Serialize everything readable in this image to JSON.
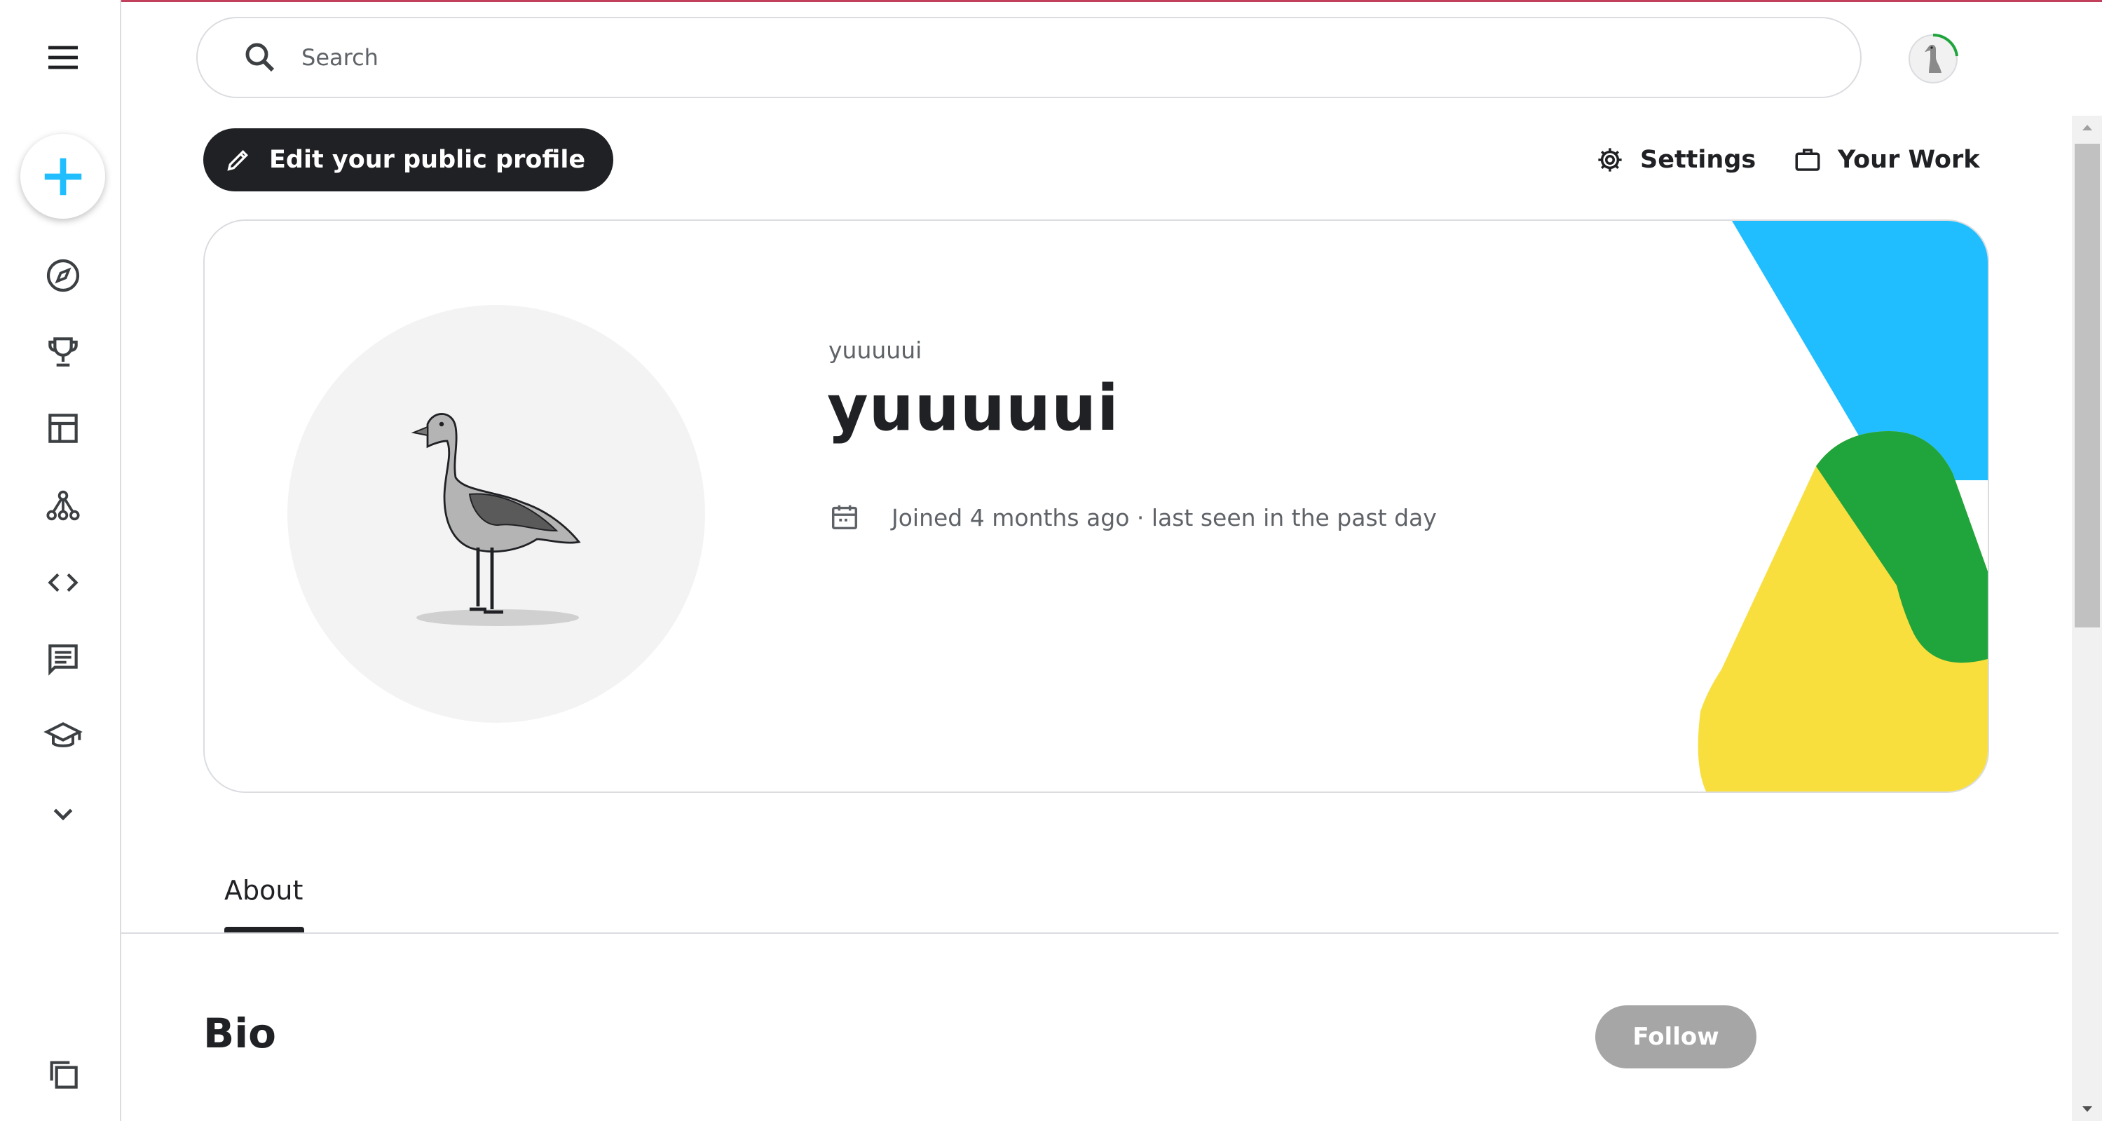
{
  "search": {
    "placeholder": "Search"
  },
  "sidebar": {
    "items": [
      {
        "icon": "menu-icon"
      },
      {
        "icon": "plus-icon"
      },
      {
        "icon": "compass-icon"
      },
      {
        "icon": "trophy-icon"
      },
      {
        "icon": "table-icon"
      },
      {
        "icon": "models-icon"
      },
      {
        "icon": "code-icon"
      },
      {
        "icon": "discussion-icon"
      },
      {
        "icon": "learn-icon"
      },
      {
        "icon": "chevron-down-icon"
      },
      {
        "icon": "copy-icon"
      }
    ]
  },
  "toolbar": {
    "edit_label": "Edit your public profile",
    "settings_label": "Settings",
    "your_work_label": "Your Work"
  },
  "profile": {
    "username": "yuuuuui",
    "display_name": "yuuuuui",
    "joined_text": "Joined 4 months ago · last seen in the past day"
  },
  "tabs": [
    {
      "label": "About",
      "active": true
    }
  ],
  "bio": {
    "heading": "Bio",
    "follow_label": "Follow"
  },
  "colors": {
    "accent_blue": "#20beff",
    "art_blue": "#20beff",
    "art_green": "#20a43c",
    "art_yellow": "#f8df3e",
    "dark": "#202124",
    "follow_disabled": "#a6a6a6",
    "progress_green": "#20a43c"
  }
}
